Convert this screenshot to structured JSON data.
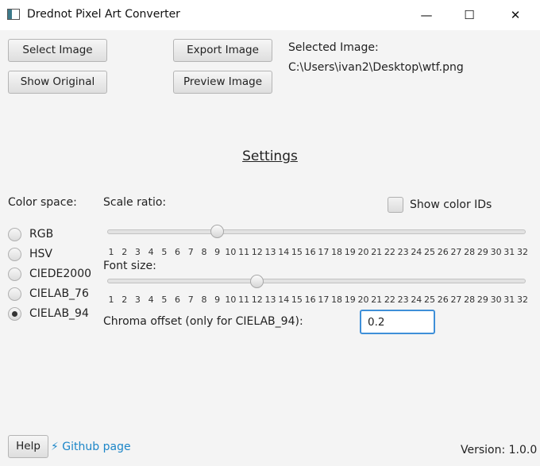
{
  "window": {
    "title": "Drednot Pixel Art Converter",
    "minimize": "—",
    "maximize": "☐",
    "close": "✕"
  },
  "toolbar": {
    "select_image": "Select Image",
    "show_original": "Show Original",
    "export_image": "Export Image",
    "preview_image": "Preview Image"
  },
  "selected": {
    "label": "Selected Image:",
    "path": "C:\\Users\\ivan2\\Desktop\\wtf.png"
  },
  "settings": {
    "heading": "Settings",
    "color_space_label": "Color space:",
    "color_spaces": [
      "RGB",
      "HSV",
      "CIEDE2000",
      "CIELAB_76",
      "CIELAB_94"
    ],
    "color_space_selected": "CIELAB_94",
    "scale_ratio": {
      "label": "Scale ratio:",
      "min": 1,
      "max": 32,
      "value": 9
    },
    "show_color_ids": {
      "label": "Show color IDs",
      "checked": false
    },
    "font_size": {
      "label": "Font size:",
      "min": 1,
      "max": 32,
      "value": 12
    },
    "chroma_offset": {
      "label": "Chroma offset (only for CIELAB_94):",
      "value": "0.2"
    },
    "tick_labels": [
      "1",
      "2",
      "3",
      "4",
      "5",
      "6",
      "7",
      "8",
      "9",
      "10",
      "11",
      "12",
      "13",
      "14",
      "15",
      "16",
      "17",
      "18",
      "19",
      "20",
      "21",
      "22",
      "23",
      "24",
      "25",
      "26",
      "27",
      "28",
      "29",
      "30",
      "31",
      "32"
    ]
  },
  "footer": {
    "help": "Help",
    "github_icon": "⚡",
    "github_link": "Github page",
    "version": "Version: 1.0.0"
  },
  "colors": {
    "accent": "#3e8fd8",
    "link": "#1c86c8",
    "background": "#f4f4f4"
  }
}
